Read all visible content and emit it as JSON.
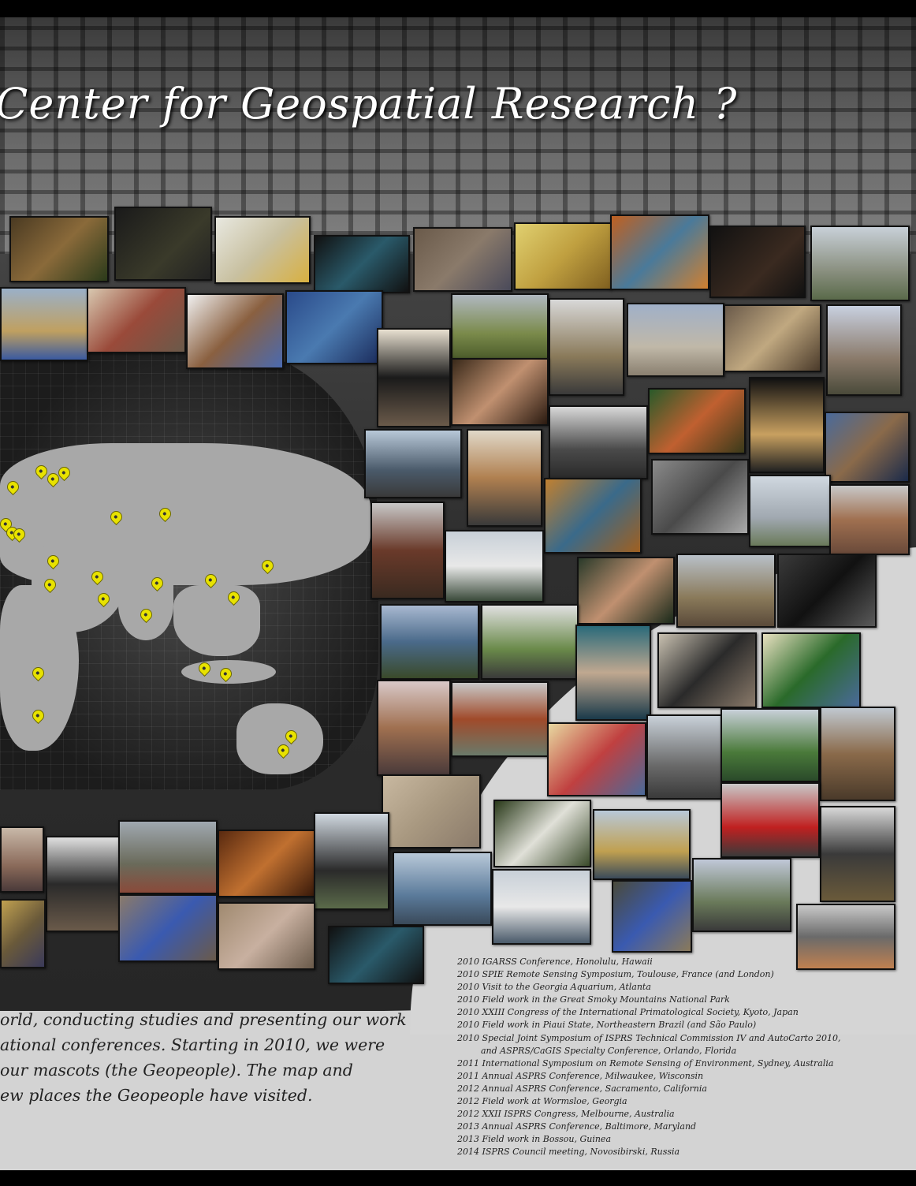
{
  "title": "Center for Geospatial Research ?",
  "description_lines": [
    "orld, conducting studies and presenting our work",
    "ational conferences. Starting in 2010, we were",
    "our mascots (the Geopeople). The map and",
    "ew places the Geopeople have visited."
  ],
  "events": [
    "2010 IGARSS Conference, Honolulu, Hawaii",
    "2010 SPIE Remote Sensing Symposium, Toulouse, France (and London)",
    "2010 Visit to the Georgia Aquarium, Atlanta",
    "2010 Field work in the Great Smoky Mountains National Park",
    "2010 XXIII Congress of the International Primatological Society, Kyoto, Japan",
    "2010 Field work in Piaui State, Northeastern Brazil (and São Paulo)",
    "2010 Special Joint Symposium of ISPRS Technical Commission IV and AutoCarto 2010,",
    "and ASPRS/CaGIS Specialty Conference, Orlando, Florida",
    "2011 International Symposium on Remote Sensing of Environment, Sydney, Australia",
    "2011 Annual ASPRS Conference, Milwaukee, Wisconsin",
    "2012 Annual ASPRS Conference, Sacramento, California",
    "2012 Field work at Wormsloe, Georgia",
    "2012 XXII ISPRS Congress, Melbourne, Australia",
    "2013 Annual ASPRS Conference, Baltimore, Maryland",
    "2013 Field work in Bossou, Guinea",
    "2014 ISPRS Council meeting, Novosibirski, Russia"
  ],
  "colors": {
    "pin": "#e8e200",
    "title": "#ffffff",
    "background_light": "#d3d3d3",
    "background_dark": "#2e2e2e"
  },
  "map_pin_icon": "map-marker-icon"
}
